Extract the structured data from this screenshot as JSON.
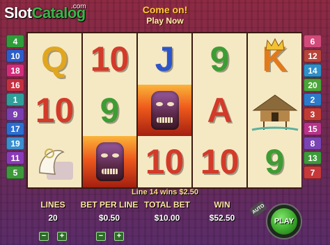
{
  "branding": {
    "slot": "Slot",
    "catalog": "Catalog",
    "com": ".com"
  },
  "promo": {
    "line1": "Come on!",
    "line2": "Play Now"
  },
  "paylines_left": [
    {
      "n": "4",
      "color": "#2e9e3a"
    },
    {
      "n": "10",
      "color": "#2c5ec9"
    },
    {
      "n": "18",
      "color": "#d12d7a"
    },
    {
      "n": "16",
      "color": "#c43040"
    },
    {
      "n": "1",
      "color": "#2f9f9a"
    },
    {
      "n": "9",
      "color": "#7a3fb0"
    },
    {
      "n": "17",
      "color": "#2c6fd2"
    },
    {
      "n": "19",
      "color": "#3a8fcf"
    },
    {
      "n": "11",
      "color": "#8a3bb8"
    },
    {
      "n": "5",
      "color": "#3d9a3a"
    }
  ],
  "paylines_right": [
    {
      "n": "6",
      "color": "#d24a7a"
    },
    {
      "n": "12",
      "color": "#b8443a"
    },
    {
      "n": "14",
      "color": "#2f8fc9"
    },
    {
      "n": "20",
      "color": "#4aa53a"
    },
    {
      "n": "2",
      "color": "#2c7ac9"
    },
    {
      "n": "3",
      "color": "#c13b35"
    },
    {
      "n": "15",
      "color": "#b8338a"
    },
    {
      "n": "8",
      "color": "#7a44b5"
    },
    {
      "n": "13",
      "color": "#3e9a3a"
    },
    {
      "n": "7",
      "color": "#c6383a"
    }
  ],
  "reels": [
    [
      {
        "t": "Q",
        "c": "gold"
      },
      {
        "t": "10",
        "c": "red"
      },
      {
        "t": "shell",
        "c": "icon"
      }
    ],
    [
      {
        "t": "10",
        "c": "red"
      },
      {
        "t": "9",
        "c": "green"
      },
      {
        "t": "tiki",
        "c": "icon"
      }
    ],
    [
      {
        "t": "J",
        "c": "blue"
      },
      {
        "t": "tiki",
        "c": "icon"
      },
      {
        "t": "10",
        "c": "red"
      }
    ],
    [
      {
        "t": "9",
        "c": "green"
      },
      {
        "t": "A",
        "c": "red"
      },
      {
        "t": "10",
        "c": "red"
      }
    ],
    [
      {
        "t": "K",
        "c": "orange"
      },
      {
        "t": "hut",
        "c": "icon"
      },
      {
        "t": "9",
        "c": "green"
      }
    ]
  ],
  "win_message": "Line 14 wins $2.50",
  "stats": {
    "lines_label": "LINES",
    "lines_value": "20",
    "bet_label": "BET PER LINE",
    "bet_value": "$0.50",
    "total_label": "TOTAL BET",
    "total_value": "$10.00",
    "win_label": "WIN",
    "win_value": "$52.50"
  },
  "controls": {
    "minus": "−",
    "plus": "+",
    "play_label": "PLAY",
    "auto_label": "AUTO"
  }
}
